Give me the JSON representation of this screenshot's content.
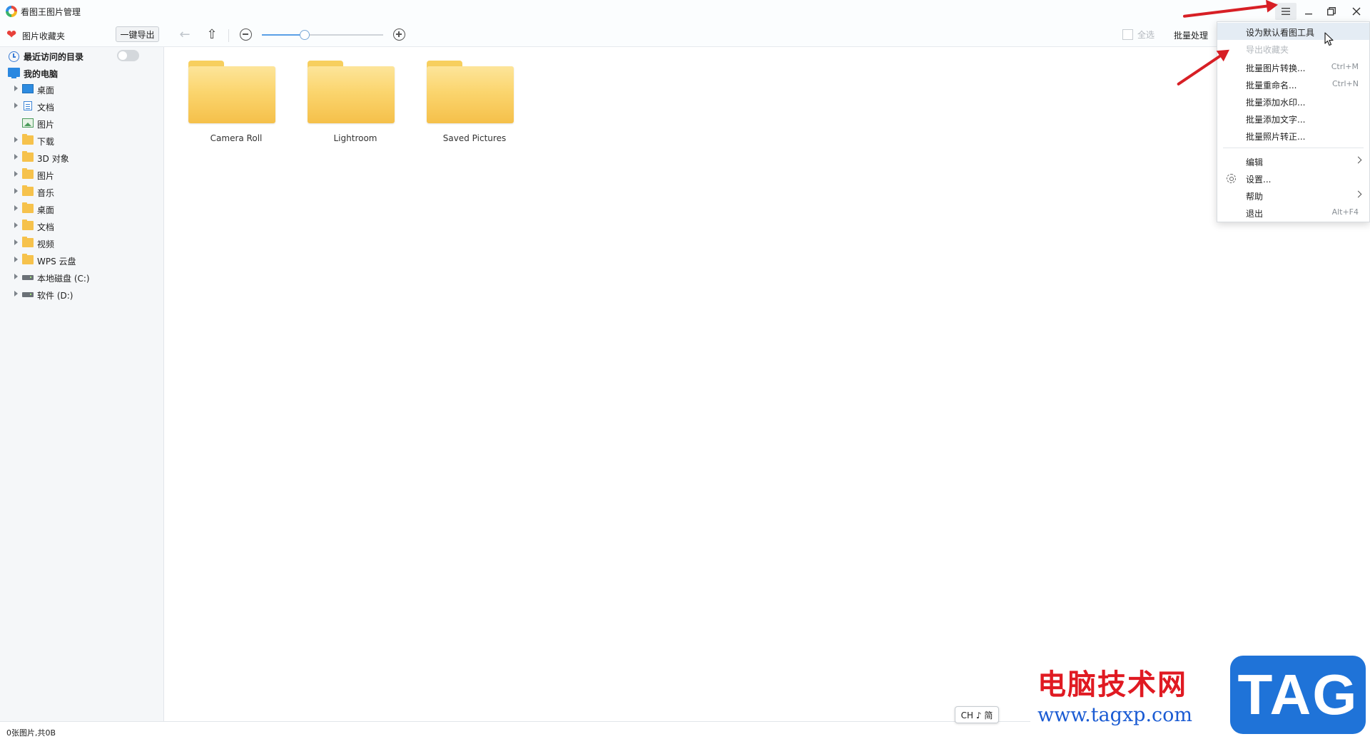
{
  "window": {
    "title": "看图王图片管理",
    "controls": {
      "menu_icon": "hamburger-icon",
      "minimize_icon": "minimize-icon",
      "restore_icon": "restore-icon",
      "close_icon": "close-icon"
    }
  },
  "toolbar": {
    "favorites_label": "图片收藏夹",
    "export_button": "一键导出",
    "select_all": "全选",
    "batch_process": "批量处理",
    "zoom_level": 0.35
  },
  "sidebar": {
    "recent_label": "最近访问的目录",
    "pc_label": "我的电脑",
    "items": [
      {
        "label": "桌面",
        "icon": "desktop",
        "expandable": true
      },
      {
        "label": "文档",
        "icon": "document",
        "expandable": true
      },
      {
        "label": "图片",
        "icon": "picture",
        "expandable": false
      },
      {
        "label": "下载",
        "icon": "folder",
        "expandable": true
      },
      {
        "label": "3D 对象",
        "icon": "folder",
        "expandable": true
      },
      {
        "label": "图片",
        "icon": "folder",
        "expandable": true
      },
      {
        "label": "音乐",
        "icon": "folder",
        "expandable": true
      },
      {
        "label": "桌面",
        "icon": "folder",
        "expandable": true
      },
      {
        "label": "文档",
        "icon": "folder",
        "expandable": true
      },
      {
        "label": "视频",
        "icon": "folder",
        "expandable": true
      },
      {
        "label": "WPS 云盘",
        "icon": "folder",
        "expandable": true
      },
      {
        "label": "本地磁盘 (C:)",
        "icon": "drive",
        "expandable": true
      },
      {
        "label": "软件 (D:)",
        "icon": "drive",
        "expandable": true
      }
    ]
  },
  "main": {
    "folders": [
      {
        "name": "Camera Roll"
      },
      {
        "name": "Lightroom"
      },
      {
        "name": "Saved Pictures"
      }
    ]
  },
  "menu": {
    "items": [
      {
        "label": "设为默认看图工具",
        "shortcut": "",
        "state": "hover"
      },
      {
        "label": "导出收藏夹",
        "shortcut": "",
        "state": "disabled"
      },
      {
        "label": "批量图片转换...",
        "shortcut": "Ctrl+M",
        "state": "normal"
      },
      {
        "label": "批量重命名...",
        "shortcut": "Ctrl+N",
        "state": "normal"
      },
      {
        "label": "批量添加水印...",
        "shortcut": "",
        "state": "normal"
      },
      {
        "label": "批量添加文字...",
        "shortcut": "",
        "state": "normal"
      },
      {
        "label": "批量照片转正...",
        "shortcut": "",
        "state": "normal"
      },
      {
        "label": "编辑",
        "shortcut": "",
        "state": "submenu"
      },
      {
        "label": "设置...",
        "shortcut": "",
        "state": "normal"
      },
      {
        "label": "帮助",
        "shortcut": "",
        "state": "submenu"
      },
      {
        "label": "退出",
        "shortcut": "Alt+F4",
        "state": "normal"
      }
    ]
  },
  "statusbar": {
    "text": "0张图片,共0B"
  },
  "ime": {
    "text": "CH ♪ 简"
  },
  "watermark": {
    "site_name": "电脑技术网",
    "site_url": "www.tagxp.com",
    "logo_text": "TAG"
  },
  "colors": {
    "accent": "#2b88e0",
    "annotation": "#d71f25",
    "folder": "#f7cf5e"
  }
}
